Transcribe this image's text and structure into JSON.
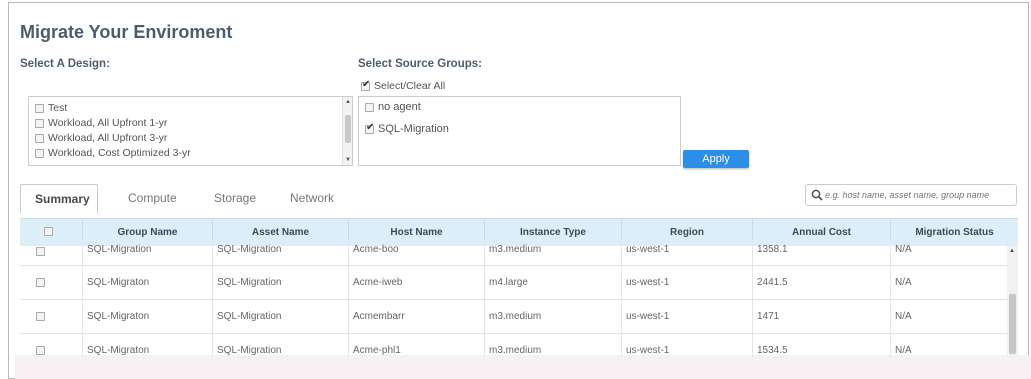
{
  "page_title": "Migrate Your Enviroment",
  "design": {
    "label": "Select A Design:",
    "options": [
      {
        "label": "Test",
        "checked": false
      },
      {
        "label": "Workload, All Upfront 1-yr",
        "checked": false
      },
      {
        "label": "Workload, All Upfront 3-yr",
        "checked": false
      },
      {
        "label": "Workload, Cost Optimized 3-yr",
        "checked": false
      }
    ]
  },
  "groups": {
    "label": "Select Source Groups:",
    "select_all_label": "Select/Clear All",
    "select_all_checked": true,
    "options": [
      {
        "label": "no agent",
        "checked": false
      },
      {
        "label": "SQL-Migration",
        "checked": true
      }
    ],
    "apply_label": "Apply"
  },
  "tabs": [
    {
      "label": "Summary",
      "active": true
    },
    {
      "label": "Compute",
      "active": false
    },
    {
      "label": "Storage",
      "active": false
    },
    {
      "label": "Network",
      "active": false
    }
  ],
  "search": {
    "placeholder": "e.g. host name, asset name, group name"
  },
  "table": {
    "columns": [
      "Group Name",
      "Asset Name",
      "Host Name",
      "Instance Type",
      "Region",
      "Annual Cost",
      "Migration Status"
    ],
    "rows": [
      {
        "group": "SQL-Migration",
        "asset": "SQL-Migration",
        "host": "Acme-boo",
        "instance": "m3.medium",
        "region": "us-west-1",
        "cost": "1358.1",
        "status": "N/A"
      },
      {
        "group": "SQL-Migraton",
        "asset": "SQL-Migration",
        "host": "Acme-iweb",
        "instance": "m4.large",
        "region": "us-west-1",
        "cost": "2441.5",
        "status": "N/A"
      },
      {
        "group": "SQL-Migraton",
        "asset": "SQL-Migration",
        "host": "Acmembarr",
        "instance": "m3.medium",
        "region": "us-west-1",
        "cost": "1471",
        "status": "N/A"
      },
      {
        "group": "SQL-Migraton",
        "asset": "SQL-Migration",
        "host": "Acme-phl1",
        "instance": "m3.medium",
        "region": "us-west-1",
        "cost": "1534.5",
        "status": "N/A"
      }
    ]
  },
  "colors": {
    "title": "#4d5d6e",
    "apply_button": "#2d8ee8",
    "table_header": "#dceef7"
  }
}
